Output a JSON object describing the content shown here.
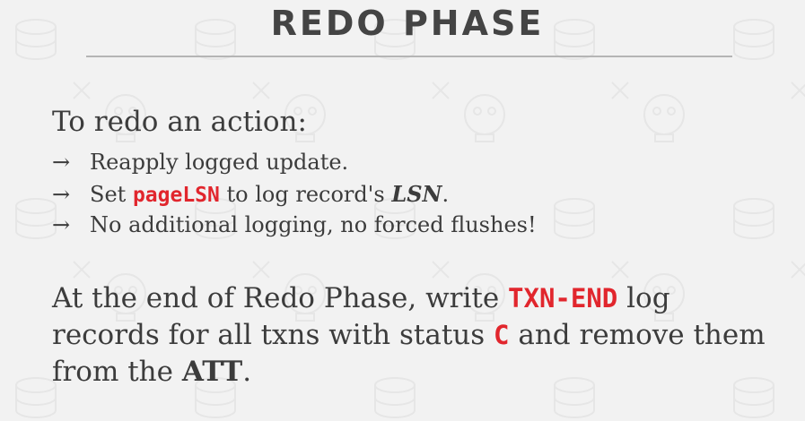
{
  "slide": {
    "title": "REDO PHASE",
    "heading": "To redo an action:",
    "arrow": "→",
    "bullets": [
      {
        "text": "Reapply logged update."
      },
      {
        "pre": "Set",
        "code": "pageLSN",
        "mid": "to log record's",
        "em": "LSN",
        "post": "."
      },
      {
        "text": "No additional logging, no forced flushes!"
      }
    ],
    "paragraph": {
      "l1_pre": "At the end of Redo Phase, write",
      "l1_code": "TXN-END",
      "l1_post": "log",
      "l2_pre": "records for all txns with status",
      "l2_code": "C",
      "l2_post": "and remove them",
      "l3_pre": "from the",
      "l3_bold": "ATT",
      "l3_post": "."
    }
  },
  "colors": {
    "background": "#f2f2f2",
    "text": "#3c3c3c",
    "title": "#444444",
    "accent_red": "#e1262d",
    "rule": "#b5b5b5"
  }
}
